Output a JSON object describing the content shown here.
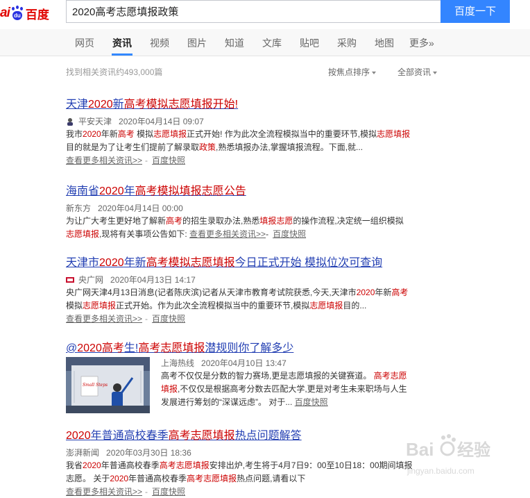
{
  "header": {
    "logo_latin_1": "ai",
    "logo_paw_text": "du",
    "logo_cn": "百度",
    "search_value": "2020高考志愿填报政策",
    "search_button": "百度一下"
  },
  "tabs": [
    {
      "label": "网页"
    },
    {
      "label": "资讯"
    },
    {
      "label": "视频"
    },
    {
      "label": "图片"
    },
    {
      "label": "知道"
    },
    {
      "label": "文库"
    },
    {
      "label": "贴吧"
    },
    {
      "label": "采购"
    },
    {
      "label": "地图"
    },
    {
      "label": "更多»"
    }
  ],
  "toolbar": {
    "count": "找到相关资讯约493,000篇",
    "sort": "按焦点排序",
    "filter": "全部资讯"
  },
  "results": [
    {
      "title_parts": [
        "天津",
        "2020",
        "新",
        "高考",
        "模拟",
        "志愿填报",
        "开始!"
      ],
      "source": "平安天津",
      "time": "2020年04月14日 09:07",
      "abs1": [
        "我市",
        "2020",
        "年新",
        "高考",
        " 模拟",
        "志愿填报",
        "正式开始! 作为此次全流程模拟当中的重要环节,模拟",
        "志愿填报"
      ],
      "abs2": [
        "目的就是为了让考生们提前了解录取",
        "政策",
        ",熟悉填报办法,掌握填报流程。下面,就..."
      ],
      "more": "查看更多相关资讯>>",
      "sep": "-",
      "snapshot": "百度快照"
    },
    {
      "title_parts": [
        "海南省",
        "2020",
        "年",
        "高考",
        "模拟",
        "填报",
        "志愿",
        "公告"
      ],
      "source": "新东方",
      "time": "2020年04月14日 00:00",
      "abs1": [
        "为让广大考生更好地了解新",
        "高考",
        "的招生录取办法,熟悉",
        "填报",
        "志愿",
        "的操作流程,决定统一组织模拟"
      ],
      "abs2": [
        "志愿填报",
        ",现将有关事项公告如下: "
      ],
      "more": "查看更多相关资讯>>",
      "sep": "-",
      "snapshot": "百度快照"
    },
    {
      "title_parts": [
        "天津市",
        "2020",
        "年新",
        "高考",
        "模拟",
        "志愿填报",
        "今日正式开始 模拟位次可查询"
      ],
      "source": "央广网",
      "time": "2020年04月13日 14:17",
      "abs1": [
        "央广网天津4月13日消息(记者陈庆滨)记者从天津市教育考试院获悉,今天,天津市",
        "2020",
        "年新",
        "高考"
      ],
      "abs2": [
        "模拟",
        "志愿填报",
        "正式开始。作为此次全流程模拟当中的重要环节,模拟",
        "志愿填报",
        "目的..."
      ],
      "more": "查看更多相关资讯>>",
      "sep": "-",
      "snapshot": "百度快照"
    },
    {
      "title_parts": [
        "@",
        "2020",
        "高考",
        "生!",
        "高考",
        "志愿填报",
        "潜规则你了解多少"
      ],
      "source": "上海热线",
      "time": "2020年04月10日 13:47",
      "abs1": [
        "高考不仅仅是分数的智力赛场,更是志愿填报的关键赛道。 ",
        "高考志愿"
      ],
      "abs2": [
        "填报",
        ",不仅仅是根据高考分数去匹配大学,更是对考生未来职场与人生"
      ],
      "abs3": "发展进行筹划的“深谋远虑”。 对于... ",
      "snapshot": "百度快照",
      "thumb_text": "Small Steps"
    },
    {
      "title_parts": [
        "2020",
        "年普通高校春季",
        "高考",
        "志愿填报",
        "热点问题解答"
      ],
      "source": "澎湃新闻",
      "time": "2020年03月30日 18:36",
      "abs1": [
        "我省",
        "2020",
        "年普通高校春季",
        "高考",
        "志愿填报",
        "安排出炉,考生将于4月7日9：00至10日18：00期间填报"
      ],
      "abs2": [
        "志愿。 关于",
        "2020",
        "年普通高校春季",
        "高考",
        "志愿填报",
        "热点问题,请看以下"
      ],
      "more": "查看更多相关资讯>>",
      "sep": "-",
      "snapshot": "百度快照"
    }
  ],
  "watermark": {
    "brand": "Bai",
    "cn": "经验",
    "url": "jingyan.baidu.com"
  },
  "colors": {
    "link": "#2440b3",
    "highlight": "#cc0000",
    "button": "#3385ff",
    "logo_red": "#e10602",
    "logo_blue": "#2932e1"
  }
}
